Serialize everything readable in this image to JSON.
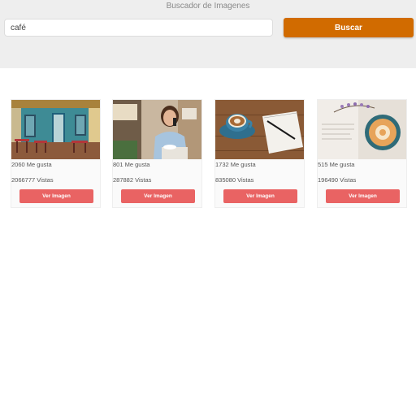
{
  "header": {
    "title": "Buscador de Imagenes",
    "search_value": "café",
    "search_button_label": "Buscar"
  },
  "colors": {
    "header_bg": "#eeeeee",
    "search_button": "#d16b00",
    "view_button": "#e96363"
  },
  "results": [
    {
      "likes": "2060 Me gusta",
      "views": "2066777 Vistas",
      "button_label": "Ver Imagen",
      "image": "cafe-street-photo"
    },
    {
      "likes": "801 Me gusta",
      "views": "287882 Vistas",
      "button_label": "Ver Imagen",
      "image": "woman-on-phone-photo"
    },
    {
      "likes": "1732 Me gusta",
      "views": "835080 Vistas",
      "button_label": "Ver Imagen",
      "image": "coffee-cup-notebook-photo"
    },
    {
      "likes": "515 Me gusta",
      "views": "196490 Vistas",
      "button_label": "Ver Imagen",
      "image": "coffee-book-flowers-photo"
    }
  ]
}
